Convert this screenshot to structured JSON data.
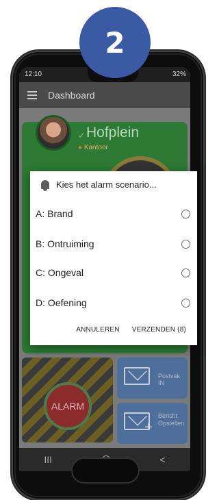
{
  "step": {
    "number": "2"
  },
  "status_bar": {
    "time": "12:10",
    "battery": "32%"
  },
  "app_bar": {
    "title": "Dashboard"
  },
  "location": {
    "name": "Hofplein",
    "subtitle": "Kantoor"
  },
  "tiles": {
    "alarm_label": "ALARM",
    "inbox_label": "Postvak IN",
    "compose_label_line1": "Bericht",
    "compose_label_line2": "Opstellen"
  },
  "dialog": {
    "title": "Kies het alarm scenario...",
    "options": [
      {
        "label": "A: Brand"
      },
      {
        "label": "B: Ontruiming"
      },
      {
        "label": "C: Ongeval"
      },
      {
        "label": "D: Oefening"
      }
    ],
    "cancel_label": "ANNULEREN",
    "send_label": "VERZENDEN (8)"
  },
  "navbar": {
    "recent": "III",
    "back": "<"
  },
  "colors": {
    "badge": "#3a5aa3",
    "location_card": "#2c7a33",
    "tile_blue": "#4f6f9b",
    "alarm_red": "#8b2b2b"
  }
}
